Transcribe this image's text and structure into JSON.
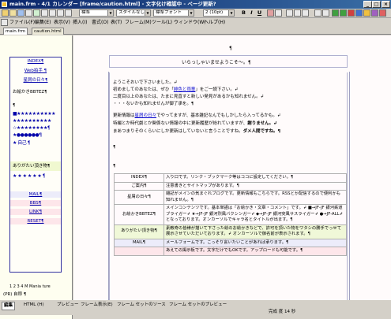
{
  "window": {
    "title": "main.frm - 4/1 カレンダー [frame/caution.html] - 文字化け確認中 - ページ更新?",
    "min": "_",
    "max": "□",
    "close": "×"
  },
  "toolbar": {
    "style_select": "標準",
    "class_select": "スタイルなし",
    "font_select": "標準フォント",
    "size_select": "2 (10pt)",
    "bold": "B",
    "italic": "I",
    "underline": "U"
  },
  "menu": [
    "ファイル(F)",
    "編集(E)",
    "表示(V)",
    "挿入(I)",
    "書式(O)",
    "表(T)",
    "フレーム(M)",
    "ツール(L)",
    "ウィンドウ(W)",
    "ヘルプ(H)"
  ],
  "file_tabs": [
    "main.frm",
    "caution.html"
  ],
  "left": {
    "nav_top": [
      "INDEX¶",
      "Web拍手 ¶",
      "星屑の日々¶"
    ],
    "blog_label": "お絵かきBBTEZ¶",
    "star_rows": [
      "¶",
      "■★★★★★★★★★★",
      "★★★★★★★★★★",
      "☆★★★★★★★★¶",
      "★●●●●●●¶",
      "★ 自己 ¶"
    ],
    "links_label": "ありがたい頂き物¶",
    "links_stars": "★ ★ ★ ★ ★ ★ ¶",
    "nav_bottom": [
      "MAIL¶",
      "BBS¶",
      "LINK¶",
      "RESET¶"
    ],
    "footer": "(PR) 自称 ¶",
    "counter": "1 2 3 4 M Mania ture"
  },
  "main": {
    "heading": "¶",
    "welcome": "いらっしゃいませようこそ～。¶",
    "intro_lines": [
      "ようこそおいで下さいました。↲",
      "初めましてのあなたは、ぜひ「",
      "二度目以上のあなたは、たまに見直すと新しい発見があるかも知れません。↲",
      "・・・ないかも知れませんが御了承を。¶"
    ],
    "intro_link": "緋色と雨童",
    "intro_link_tail": "」をご一読下さい。↲",
    "update_lines": [
      "更新情報は",
      "特撮とか時代劇とか関係ない情報の中に更新履歴が紛れていますが、",
      "まあつまりそのくらいにしか更新はしていないと言うことですね。"
    ],
    "update_link": "星屑の日々",
    "update_tail": "でやってますが、基本雑記なんでもしかしたら入ってるかも。↲",
    "update_bold_1": "謝りません。↲",
    "update_bold_2": "ダメ人間ですね。¶",
    "pilcrows": [
      "¶",
      "¶"
    ],
    "table": [
      {
        "key": "INDEX¶",
        "value": "入り口です。リンク・ブックマーク等はココに設定してください。¶"
      },
      {
        "key": "ご案内¶",
        "value": "注意書きとサイトマップがあります。¶"
      },
      {
        "key": "星屑の日々¶",
        "value": "雑記がメインの気まぐれブログです。更新情報もこちらです。RSSとか配信するので便利かも知れません。¶"
      },
      {
        "key": "お絵かきBBTEZ¶",
        "value": "メインコンテンツです。基本単語は「お絵かき・文章・コメント」です。↲ ■→JF-JF 銀河鉄道ブライガー↲ ★→JF-JF 銀河烈風バクシンガー↲ ◆→JF-JF 銀河突風サスライガー↲ ●→JF-ALL↲ となっております。オンカーソルでキャラ名とタイトルが出ます。¶"
      },
      {
        "key": "ありがたい頂き物¶",
        "value": "素敵奇の皆様が描いて下さった絵のお絵かきなどで、許可を頂いた物をワタシの勝手でっせて展示させていただいております。↲ オンカーソルで御名前が表示されます。¶"
      },
      {
        "key": "MAIL¶",
        "value": "メールフォームです。こっそり言いたいことがあれば承ります。¶"
      },
      {
        "key": "",
        "value": "あえての掲示板です。文字だけでもOKです。アップロードも可能です。¶"
      }
    ]
  },
  "bottom": {
    "tabs": [
      "編集",
      "HTML (H)",
      "プレビュー",
      "フレーム表示(E)",
      "フレーム セットのソース",
      "フレーム セットのプレビュー"
    ],
    "status": "完成 度 14 秒"
  },
  "colors": {
    "title_bar": "#0a246a",
    "nav_border": "#3030a0",
    "link": "#0000cc",
    "row_green": "#f0f8d8",
    "row_pink": "#fde6ea",
    "row_lavender": "#ececfa"
  }
}
